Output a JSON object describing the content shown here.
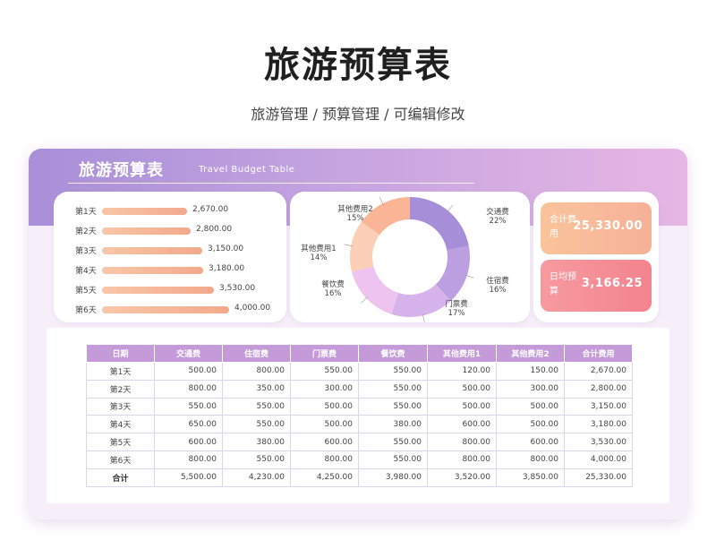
{
  "header": {
    "title": "旅游预算表",
    "subtitle": "旅游管理 / 预算管理 /  可编辑修改"
  },
  "card": {
    "title": "旅游预算表",
    "title_en": "Travel Budget Table"
  },
  "daily_bars": [
    {
      "label": "第1天",
      "value": 2670,
      "value_text": "2,670.00"
    },
    {
      "label": "第2天",
      "value": 2800,
      "value_text": "2,800.00"
    },
    {
      "label": "第3天",
      "value": 3150,
      "value_text": "3,150.00"
    },
    {
      "label": "第4天",
      "value": 3180,
      "value_text": "3,180.00"
    },
    {
      "label": "第5天",
      "value": 3530,
      "value_text": "3,530.00"
    },
    {
      "label": "第6天",
      "value": 4000,
      "value_text": "4,000.00"
    }
  ],
  "donut": [
    {
      "name": "交通费",
      "pct": 22,
      "pct_text": "22%",
      "color": "#a68fd8"
    },
    {
      "name": "住宿费",
      "pct": 16,
      "pct_text": "16%",
      "color": "#bb9fe0"
    },
    {
      "name": "门票费",
      "pct": 17,
      "pct_text": "17%",
      "color": "#d6b3ea"
    },
    {
      "name": "餐饮费",
      "pct": 16,
      "pct_text": "16%",
      "color": "#eec3ef"
    },
    {
      "name": "其他费用1",
      "pct": 14,
      "pct_text": "14%",
      "color": "#fbd0b6"
    },
    {
      "name": "其他费用2",
      "pct": 15,
      "pct_text": "15%",
      "color": "#f9b595"
    }
  ],
  "stats": {
    "total_label": "合计费用",
    "total_value": "25,330.00",
    "daily_label": "日均预算",
    "daily_value": "3,166.25"
  },
  "colors": {
    "accent_purple": "#c49ad8",
    "bar_orange": "#f3a98b",
    "total_box": "#f9c49a",
    "daily_box": "#f3838f"
  },
  "table": {
    "headers": [
      "日期",
      "交通费",
      "住宿费",
      "门票费",
      "餐饮费",
      "其他费用1",
      "其他费用2",
      "合计费用"
    ],
    "rows": [
      [
        "第1天",
        "500.00",
        "800.00",
        "550.00",
        "550.00",
        "120.00",
        "150.00",
        "2,670.00"
      ],
      [
        "第2天",
        "800.00",
        "350.00",
        "300.00",
        "550.00",
        "500.00",
        "300.00",
        "2,800.00"
      ],
      [
        "第3天",
        "550.00",
        "550.00",
        "500.00",
        "550.00",
        "500.00",
        "500.00",
        "3,150.00"
      ],
      [
        "第4天",
        "650.00",
        "550.00",
        "500.00",
        "380.00",
        "600.00",
        "500.00",
        "3,180.00"
      ],
      [
        "第5天",
        "600.00",
        "380.00",
        "600.00",
        "550.00",
        "800.00",
        "600.00",
        "3,530.00"
      ],
      [
        "第6天",
        "800.00",
        "550.00",
        "800.00",
        "550.00",
        "800.00",
        "800.00",
        "4,000.00"
      ],
      [
        "合计",
        "5,500.00",
        "4,230.00",
        "4,250.00",
        "3,980.00",
        "3,520.00",
        "3,850.00",
        "25,330.00"
      ]
    ]
  }
}
